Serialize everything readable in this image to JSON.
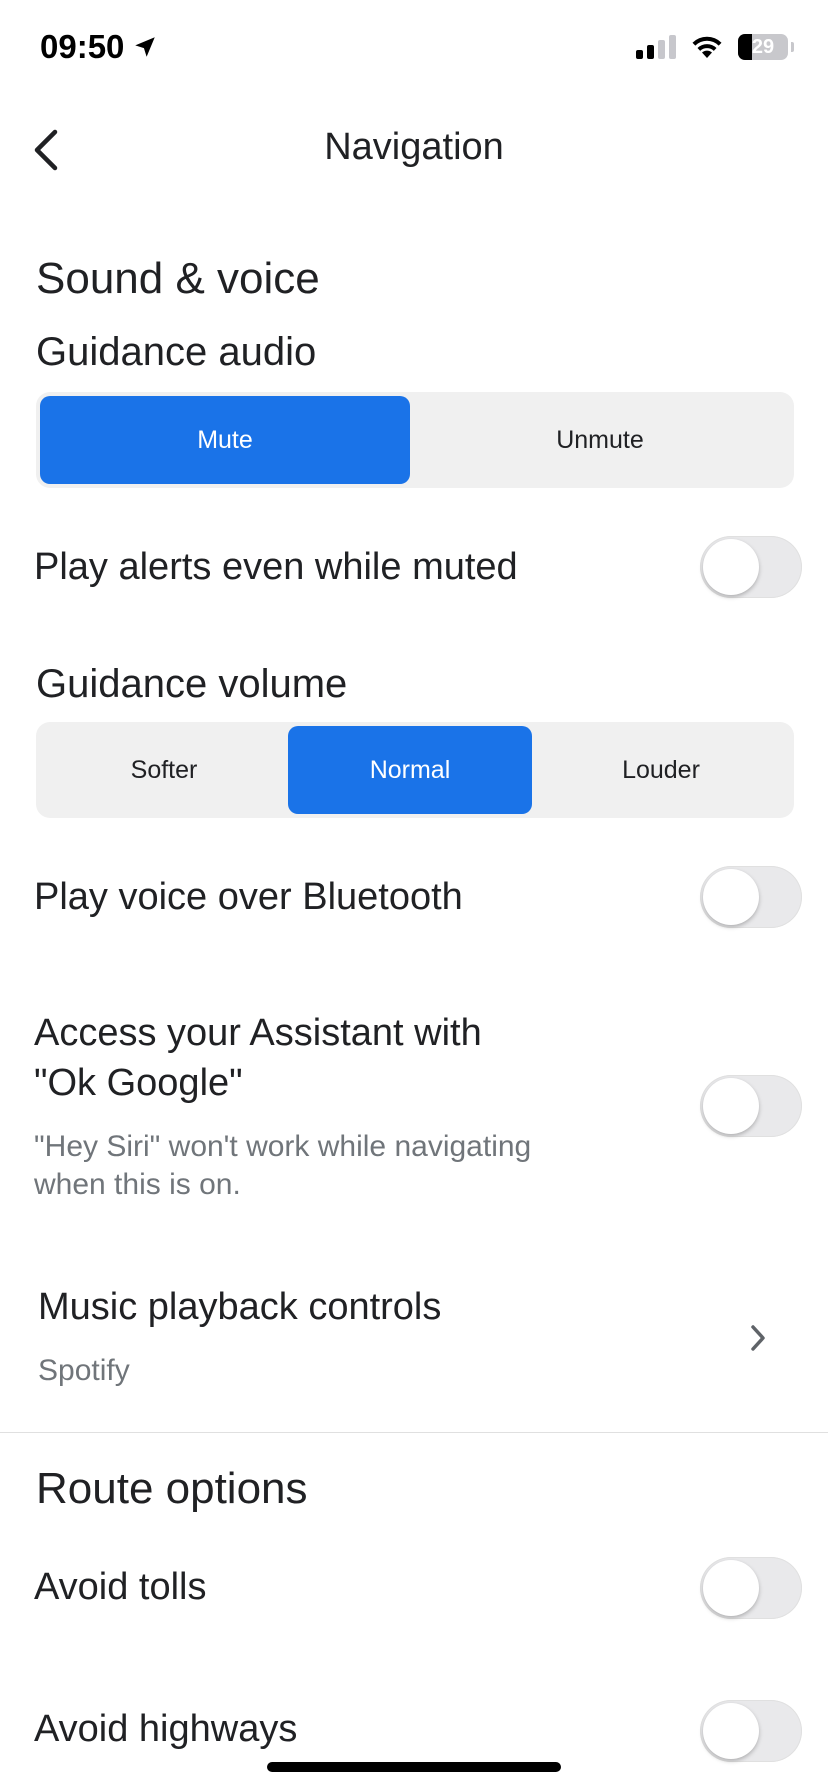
{
  "status_bar": {
    "time": "09:50",
    "battery": "29"
  },
  "header": {
    "title": "Navigation"
  },
  "sound_voice": {
    "title": "Sound & voice",
    "guidance_audio": {
      "label": "Guidance audio",
      "options": [
        "Mute",
        "Unmute"
      ],
      "selected": "Mute"
    },
    "play_alerts_muted": {
      "label": "Play alerts even while muted",
      "on": false
    },
    "guidance_volume": {
      "label": "Guidance volume",
      "options": [
        "Softer",
        "Normal",
        "Louder"
      ],
      "selected": "Normal"
    },
    "voice_bluetooth": {
      "label": "Play voice over Bluetooth",
      "on": false
    },
    "ok_google": {
      "label_line1": "Access your Assistant with",
      "label_line2": "\"Ok Google\"",
      "desc_line1": "\"Hey Siri\" won't work while navigating",
      "desc_line2": "when this is on.",
      "on": false
    },
    "music_controls": {
      "label": "Music playback controls",
      "value": "Spotify"
    }
  },
  "route_options": {
    "title": "Route options",
    "avoid_tolls": {
      "label": "Avoid tolls",
      "on": false
    },
    "avoid_highways": {
      "label": "Avoid highways",
      "on": false
    }
  },
  "colors": {
    "accent": "#1a73e8",
    "text": "#202124",
    "secondary": "#70757a"
  }
}
